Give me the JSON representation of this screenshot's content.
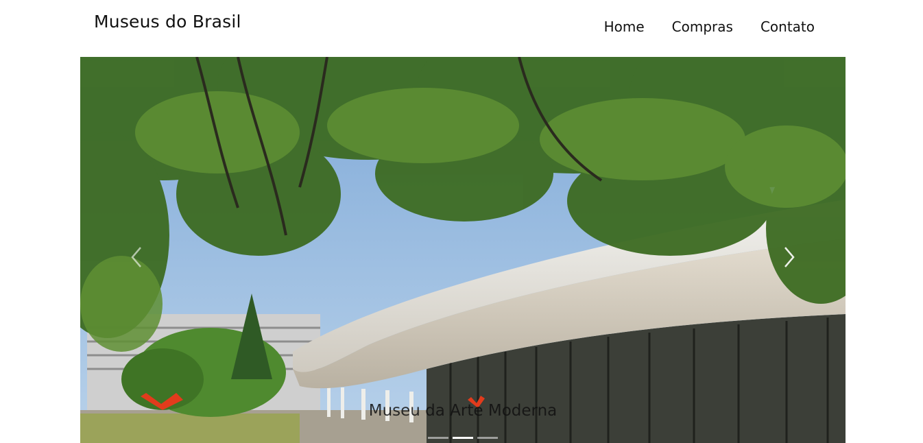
{
  "brand": "Museus do Brasil",
  "nav": {
    "home": "Home",
    "compras": "Compras",
    "contato": "Contato"
  },
  "carousel": {
    "caption": "Museu da Arte Moderna",
    "slide_count": 3,
    "active_slide": 2,
    "prev_icon": "chevron-left-icon",
    "next_icon": "chevron-right-icon"
  }
}
